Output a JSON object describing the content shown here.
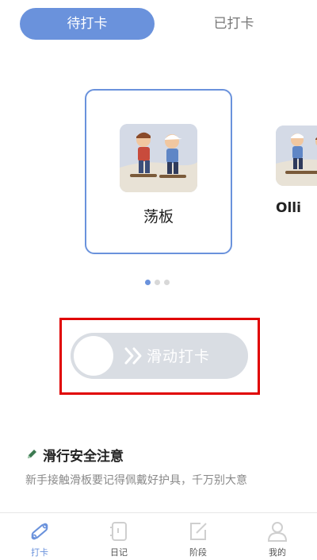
{
  "tabs": [
    {
      "label": "待打卡",
      "active": true
    },
    {
      "label": "已打卡",
      "active": false
    }
  ],
  "cards": [
    {
      "label": "荡板",
      "image": "kids-skateboarding-illustration"
    },
    {
      "label": "Olli",
      "image": "kids-skateboarding-illustration"
    }
  ],
  "carousel": {
    "page_count": 3,
    "current": 1
  },
  "slider": {
    "label": "滑动打卡",
    "icon": "double-chevron-right-icon"
  },
  "notice": {
    "icon": "pen-icon",
    "title": "滑行安全注意",
    "text": "新手接触滑板要记得佩戴好护具，千万别大意"
  },
  "nav": [
    {
      "label": "打卡",
      "icon": "skateboard-icon",
      "active": true
    },
    {
      "label": "日记",
      "icon": "diary-icon",
      "active": false
    },
    {
      "label": "阶段",
      "icon": "edit-icon",
      "active": false
    },
    {
      "label": "我的",
      "icon": "user-icon",
      "active": false
    }
  ],
  "colors": {
    "accent": "#6a92dc",
    "highlight": "#e00000",
    "slider_bg": "#d9dde3"
  }
}
